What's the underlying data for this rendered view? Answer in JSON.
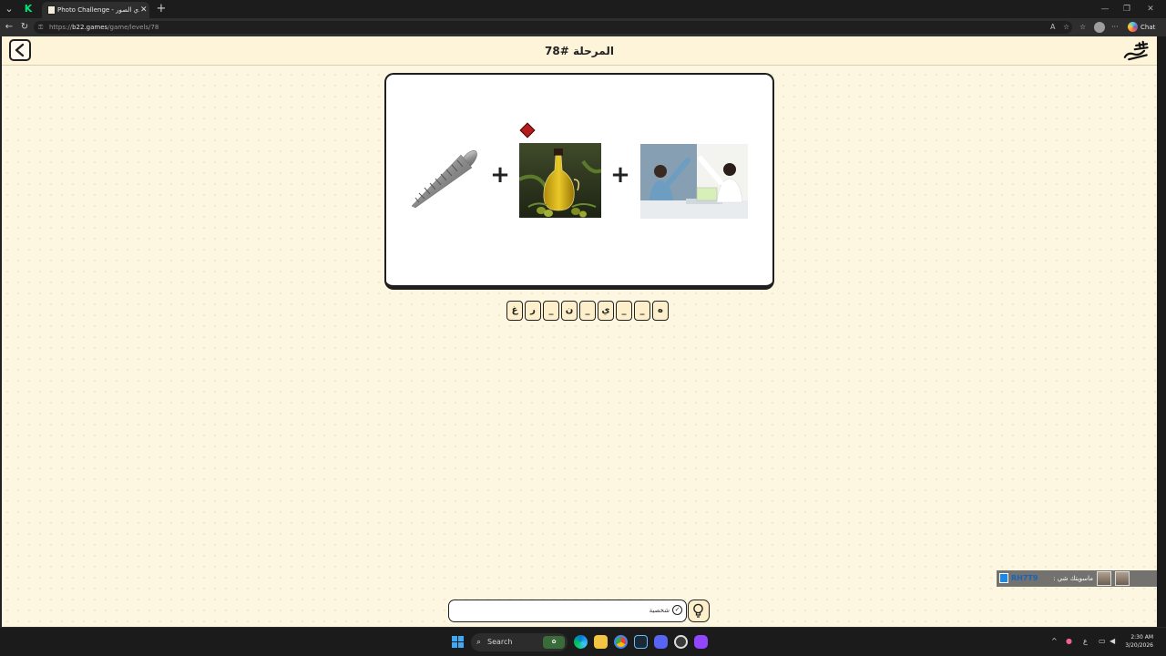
{
  "browser": {
    "active_tab_title": "Photo Challenge - لعبة تحدي الصور",
    "url_domain": "b22.games",
    "url_prefix": "https://",
    "url_path": "/game/levels/78",
    "chat_label": "Chat"
  },
  "game": {
    "level_title": "المرحلة #78",
    "logo_text": "تحدي الصور",
    "puzzle_images": [
      "screw",
      "olive-oil",
      "high-five"
    ],
    "operator": "+",
    "answer_slots": [
      "ه",
      "_",
      "_",
      "ي",
      "_",
      "ن",
      "_",
      "ر",
      "غ"
    ],
    "hint_text": "شخصية"
  },
  "chat_overlay": {
    "username": "RH7T9",
    "message": "ماسويتك شي :"
  },
  "taskbar": {
    "search_label": "Search",
    "time": "2:30 AM",
    "date": "3/20/2026"
  },
  "colors": {
    "page_background": "#fdf7e2",
    "slot_fill": "#fcefc9",
    "border": "#222222"
  }
}
